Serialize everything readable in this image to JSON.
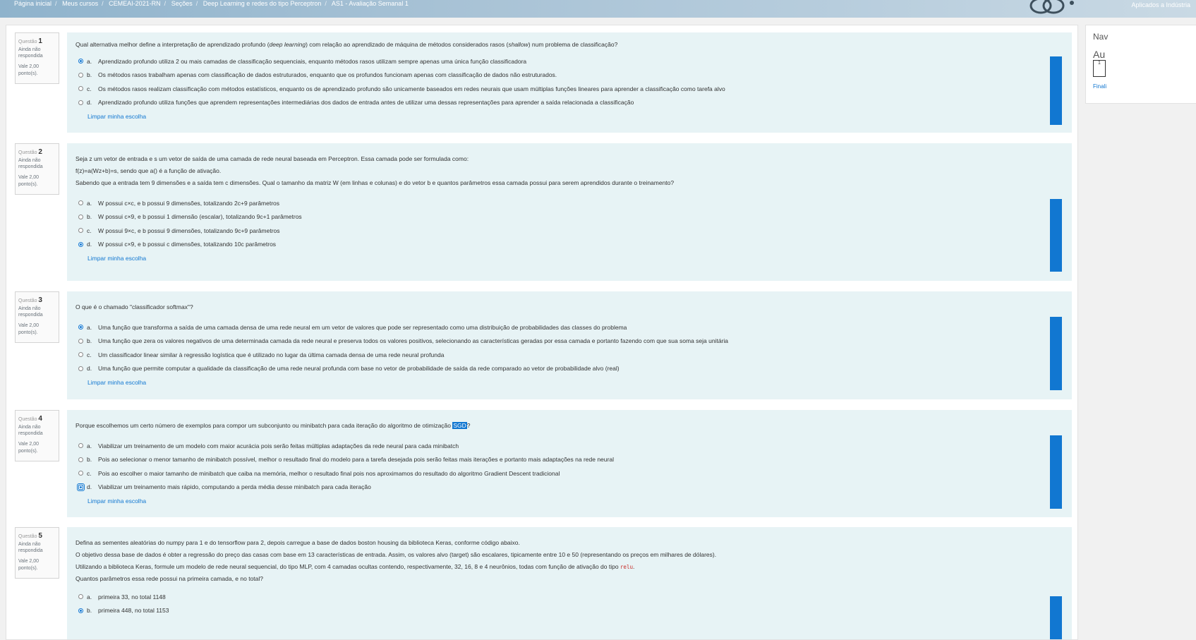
{
  "breadcrumb": [
    "Página inicial",
    "Meus cursos",
    "CEMEAI-2021-RN",
    "Seções",
    "Deep Learning e redes do tipo Perceptron",
    "AS1 - Avaliação Semanal 1"
  ],
  "brand_text": "Aplicados a Indústria",
  "nav_panel": {
    "title": "Nav",
    "subtitle": "Au",
    "box_number": "1",
    "finish": "Finali"
  },
  "clear_label": "Limpar minha escolha",
  "questions": [
    {
      "label": "Questão",
      "number": "1",
      "status": "Ainda não respondida",
      "points": "Vale 2,00 ponto(s).",
      "text_before_em": "Qual alternativa melhor define a interpretação de aprendizado profundo (",
      "em1": "deep learning",
      "text_mid": ") com relação ao aprendizado de máquina de métodos considerados rasos (",
      "em2": "shallow",
      "text_after": ") num problema de classificação?",
      "options": [
        {
          "letter": "a.",
          "text": "Aprendizado profundo utiliza 2 ou mais camadas de classificação sequenciais, enquanto métodos rasos utilizam sempre apenas uma única função classificadora",
          "selected": true
        },
        {
          "letter": "b.",
          "text": "Os métodos rasos trabalham apenas com classificação de dados estruturados, enquanto que os profundos funcionam apenas com classificação de dados não estruturados.",
          "selected": false
        },
        {
          "letter": "c.",
          "text": "Os métodos rasos realizam classificação com métodos estatísticos, enquanto os de aprendizado profundo são unicamente baseados em redes neurais que usam múltiplas funções lineares para aprender a classificação como tarefa alvo",
          "selected": false
        },
        {
          "letter": "d.",
          "text": "Aprendizado profundo utiliza funções que aprendem representações intermediárias dos dados de entrada antes de utilizar uma dessas representações para aprender a saída relacionada a classificação",
          "selected": false
        }
      ]
    },
    {
      "label": "Questão",
      "number": "2",
      "status": "Ainda não respondida",
      "points": "Vale 2,00 ponto(s).",
      "lines": [
        "Seja z um vetor de entrada e s um vetor de saída de uma camada de rede neural baseada em Perceptron. Essa camada pode ser formulada como:",
        "f(z)=a(Wz+b)=s, sendo que a() é a função de ativação.",
        "Sabendo que a entrada tem 9 dimensões e a saída tem c dimensões. Qual o tamanho da matriz W (em linhas e colunas) e do vetor b e quantos parâmetros essa camada possui para serem aprendidos durante o treinamento?"
      ],
      "options": [
        {
          "letter": "a.",
          "text": "W possui c×c, e b possui 9 dimensões, totalizando 2c+9 parâmetros",
          "selected": false
        },
        {
          "letter": "b.",
          "text": "W possui c×9, e b possui 1 dimensão (escalar), totalizando 9c+1 parâmetros",
          "selected": false
        },
        {
          "letter": "c.",
          "text": "W possui 9×c, e b possui 9 dimensões, totalizando 9c+9 parâmetros",
          "selected": false
        },
        {
          "letter": "d.",
          "text": "W possui c×9, e b possui c dimensões, totalizando 10c parâmetros",
          "selected": true
        }
      ]
    },
    {
      "label": "Questão",
      "number": "3",
      "status": "Ainda não respondida",
      "points": "Vale 2,00 ponto(s).",
      "lines": [
        "O que é o chamado \"classificador softmax\"?"
      ],
      "options": [
        {
          "letter": "a.",
          "text": "Uma função que transforma a saída de uma camada densa de uma rede neural em um vetor de valores que pode ser representado como uma distribuição de probabilidades das classes do problema",
          "selected": true
        },
        {
          "letter": "b.",
          "text": "Uma função que zera os valores negativos de uma determinada camada da rede neural e preserva todos os valores positivos, selecionando as características geradas por essa camada e portanto fazendo com que sua soma seja unitária",
          "selected": false
        },
        {
          "letter": "c.",
          "text": "Um classificador linear similar à regressão logística que é utilizado no lugar da última camada densa de uma rede neural profunda",
          "selected": false
        },
        {
          "letter": "d.",
          "text": "Uma função que permite computar a qualidade da classificação de uma rede neural profunda com base no vetor de probabilidade de saída da rede comparado ao vetor de probabilidade alvo (real)",
          "selected": false
        }
      ]
    },
    {
      "label": "Questão",
      "number": "4",
      "status": "Ainda não respondida",
      "points": "Vale 2,00 ponto(s).",
      "text_before_hl": "Porque escolhemos um certo número de exemplos para compor um subconjunto ou minibatch para cada iteração do algoritmo de otimização ",
      "hl": "SGD",
      "text_after_hl": "?",
      "options": [
        {
          "letter": "a.",
          "text": "Viabilizar um treinamento de um modelo com maior acurácia pois serão feitas múltiplas adaptações da rede neural para cada minibatch",
          "selected": false
        },
        {
          "letter": "b.",
          "text": "Pois ao selecionar o menor tamanho de minibatch possível, melhor o resultado final do modelo para a tarefa desejada pois serão feitas mais iterações e portanto mais adaptações na rede neural",
          "selected": false
        },
        {
          "letter": "c.",
          "text": "Pois ao escolher o maior tamanho de minibatch que caiba na memória, melhor o resultado final pois nos aproximamos do resultado do algoritmo Gradient Descent tradicional",
          "selected": false
        },
        {
          "letter": "d.",
          "text": "Viabilizar um treinamento mais rápido, computando a perda média desse minibatch para cada iteração",
          "selected": true
        }
      ]
    },
    {
      "label": "Questão",
      "number": "5",
      "status": "Ainda não respondida",
      "points": "Vale 2,00 ponto(s).",
      "lines": [
        "Defina as sementes aleatórias do numpy para 1 e do tensorflow para 2, depois carregue a base de dados boston housing da biblioteca Keras, conforme código abaixo.",
        "O objetivo dessa base de dados é obter a regressão do preço das casas com base em 13 características de entrada. Assim, os valores alvo (target) são escalares, tipicamente entre 10 e 50 (representando os preços em milhares de dólares)."
      ],
      "line3_before": "Utilizando a biblioteca Keras, formule um modelo de rede neural sequencial, do tipo MLP, com 4 camadas ocultas contendo, respectivamente, 32, 16, 8 e 4 neurônios, todas com função de ativação do tipo ",
      "line3_code": "relu",
      "line3_after": ".",
      "line4": "Quantos parâmetros essa rede possui na primeira camada, e no total?",
      "options": [
        {
          "letter": "a.",
          "text": "primeira 33, no total 1148",
          "selected": false
        },
        {
          "letter": "b.",
          "text": "primeira 448, no total 1153",
          "selected": true
        }
      ]
    }
  ]
}
